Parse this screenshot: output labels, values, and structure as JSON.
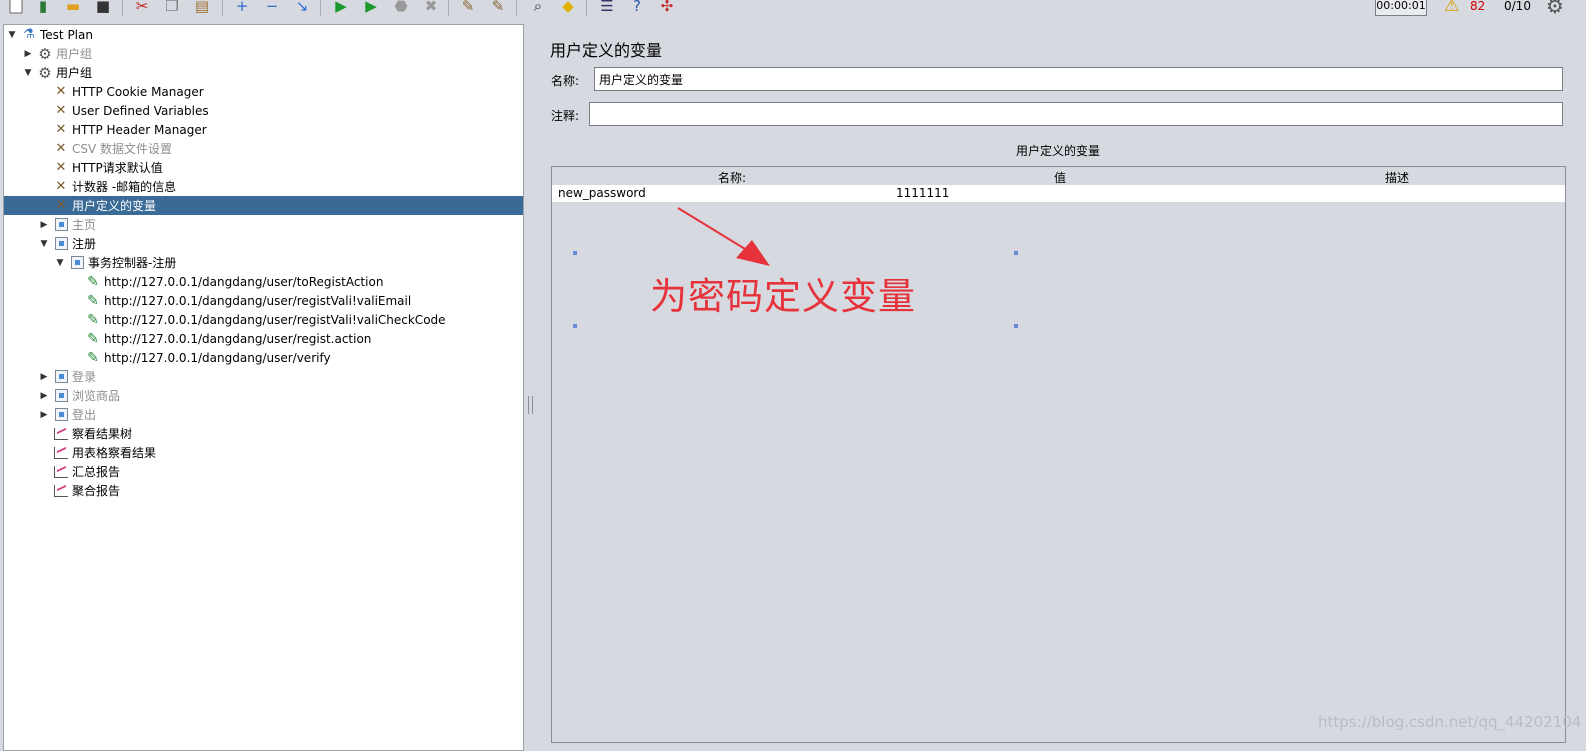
{
  "toolbar": {
    "timer": "00:00:01",
    "warning_count": "82",
    "thread_count": "0/10"
  },
  "tree": {
    "items": [
      {
        "label": "Test Plan",
        "icon": "flask-icon",
        "depth": 0,
        "toggle": "expanded",
        "disabled": false
      },
      {
        "label": "用户组",
        "icon": "gear-icon",
        "depth": 1,
        "toggle": "collapsed",
        "disabled": true
      },
      {
        "label": "用户组",
        "icon": "gear-icon",
        "depth": 1,
        "toggle": "expanded",
        "disabled": false
      },
      {
        "label": "HTTP Cookie Manager",
        "icon": "wrench-icon",
        "depth": 2,
        "toggle": "none",
        "disabled": false
      },
      {
        "label": "User Defined Variables",
        "icon": "wrench-icon",
        "depth": 2,
        "toggle": "none",
        "disabled": false
      },
      {
        "label": "HTTP Header Manager",
        "icon": "wrench-icon",
        "depth": 2,
        "toggle": "none",
        "disabled": false
      },
      {
        "label": "CSV 数据文件设置",
        "icon": "wrench-icon",
        "depth": 2,
        "toggle": "none",
        "disabled": true
      },
      {
        "label": "HTTP请求默认值",
        "icon": "wrench-icon",
        "depth": 2,
        "toggle": "none",
        "disabled": false
      },
      {
        "label": "计数器 -邮箱的信息",
        "icon": "wrench-icon",
        "depth": 2,
        "toggle": "none",
        "disabled": false
      },
      {
        "label": "用户定义的变量",
        "icon": "wrench-icon",
        "depth": 2,
        "toggle": "none",
        "disabled": false,
        "selected": true
      },
      {
        "label": "主页",
        "icon": "controller-icon",
        "depth": 2,
        "toggle": "collapsed",
        "disabled": true
      },
      {
        "label": "注册",
        "icon": "controller-icon",
        "depth": 2,
        "toggle": "expanded",
        "disabled": false
      },
      {
        "label": "事务控制器-注册",
        "icon": "controller-icon",
        "depth": 3,
        "toggle": "expanded",
        "disabled": false
      },
      {
        "label": "http://127.0.0.1/dangdang/user/toRegistAction",
        "icon": "sampler-icon",
        "depth": 4,
        "toggle": "none",
        "disabled": false
      },
      {
        "label": "http://127.0.0.1/dangdang/user/registVali!valiEmail",
        "icon": "sampler-icon",
        "depth": 4,
        "toggle": "none",
        "disabled": false
      },
      {
        "label": "http://127.0.0.1/dangdang/user/registVali!valiCheckCode",
        "icon": "sampler-icon",
        "depth": 4,
        "toggle": "none",
        "disabled": false
      },
      {
        "label": "http://127.0.0.1/dangdang/user/regist.action",
        "icon": "sampler-icon",
        "depth": 4,
        "toggle": "none",
        "disabled": false
      },
      {
        "label": "http://127.0.0.1/dangdang/user/verify",
        "icon": "sampler-icon",
        "depth": 4,
        "toggle": "none",
        "disabled": false
      },
      {
        "label": "登录",
        "icon": "controller-icon",
        "depth": 2,
        "toggle": "collapsed",
        "disabled": true
      },
      {
        "label": "浏览商品",
        "icon": "controller-icon",
        "depth": 2,
        "toggle": "collapsed",
        "disabled": true
      },
      {
        "label": "登出",
        "icon": "controller-icon",
        "depth": 2,
        "toggle": "collapsed",
        "disabled": true
      },
      {
        "label": "察看结果树",
        "icon": "chart-icon",
        "depth": 2,
        "toggle": "none",
        "disabled": false
      },
      {
        "label": "用表格察看结果",
        "icon": "chart-icon",
        "depth": 2,
        "toggle": "none",
        "disabled": false
      },
      {
        "label": "汇总报告",
        "icon": "chart-icon",
        "depth": 2,
        "toggle": "none",
        "disabled": false
      },
      {
        "label": "聚合报告",
        "icon": "chart-icon",
        "depth": 2,
        "toggle": "none",
        "disabled": false
      }
    ]
  },
  "panel": {
    "title": "用户定义的变量",
    "name_label": "名称:",
    "name_value": "用户定义的变量",
    "comment_label": "注释:",
    "comment_value": "",
    "table_title": "用户定义的变量",
    "columns": [
      "名称:",
      "值",
      "描述"
    ],
    "rows": [
      {
        "name": "new_password",
        "value": "1111111",
        "description": ""
      }
    ]
  },
  "annotation": {
    "text": "为密码定义变量",
    "color": "#e6323b"
  },
  "watermark": "https://blog.csdn.net/qq_44202104",
  "colors": {
    "selection": "#3a6a96",
    "panel_bg": "#d6d9df"
  }
}
